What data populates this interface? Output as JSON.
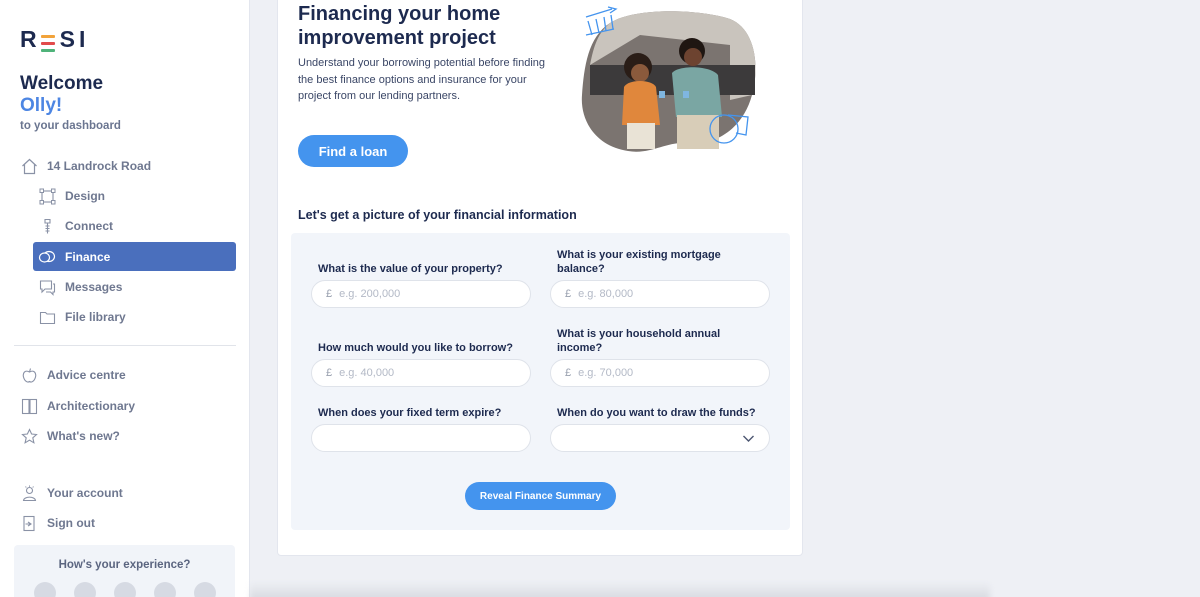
{
  "logo": {
    "text_r": "R",
    "text_si": "SI",
    "colors": [
      "#f2a33a",
      "#e24b4b",
      "#4fb37a"
    ]
  },
  "welcome": {
    "line1": "Welcome",
    "name": "Olly!",
    "subtitle": "to your dashboard"
  },
  "nav": {
    "property": "14 Landrock Road",
    "items": [
      {
        "label": "Design",
        "icon": "design-icon"
      },
      {
        "label": "Connect",
        "icon": "connect-icon"
      },
      {
        "label": "Finance",
        "icon": "finance-icon",
        "active": true
      },
      {
        "label": "Messages",
        "icon": "messages-icon"
      },
      {
        "label": "File library",
        "icon": "folder-icon"
      }
    ],
    "secondary": [
      {
        "label": "Advice centre",
        "icon": "apple-icon"
      },
      {
        "label": "Architectionary",
        "icon": "book-icon"
      },
      {
        "label": "What's new?",
        "icon": "star-icon"
      }
    ],
    "account": [
      {
        "label": "Your account",
        "icon": "user-icon"
      },
      {
        "label": "Sign out",
        "icon": "sign-out-icon"
      }
    ]
  },
  "experience": {
    "title": "How's your experience?"
  },
  "main": {
    "title": "Financing your home improvement project",
    "description": "Understand your borrowing potential before finding the best finance options and insurance for your project from our lending partners.",
    "find_loan": "Find a loan",
    "section_title": "Let's get a picture of your financial information",
    "form": {
      "property_value": {
        "label": "What is the value of your property?",
        "currency": "£",
        "placeholder": "e.g. 200,000"
      },
      "mortgage_balance": {
        "label": "What is your existing mortgage balance?",
        "currency": "£",
        "placeholder": "e.g. 80,000"
      },
      "borrow": {
        "label": "How much would you like to borrow?",
        "currency": "£",
        "placeholder": "e.g. 40,000"
      },
      "income": {
        "label": "What is your household annual income?",
        "currency": "£",
        "placeholder": "e.g. 70,000"
      },
      "fixed_term": {
        "label": "When does your fixed term expire?"
      },
      "draw_funds": {
        "label": "When do you want to draw the funds?"
      }
    },
    "reveal_button": "Reveal Finance Summary"
  },
  "colors": {
    "accent": "#4494ee",
    "active_nav": "#4a6fbd",
    "navy": "#1d2a4f"
  }
}
